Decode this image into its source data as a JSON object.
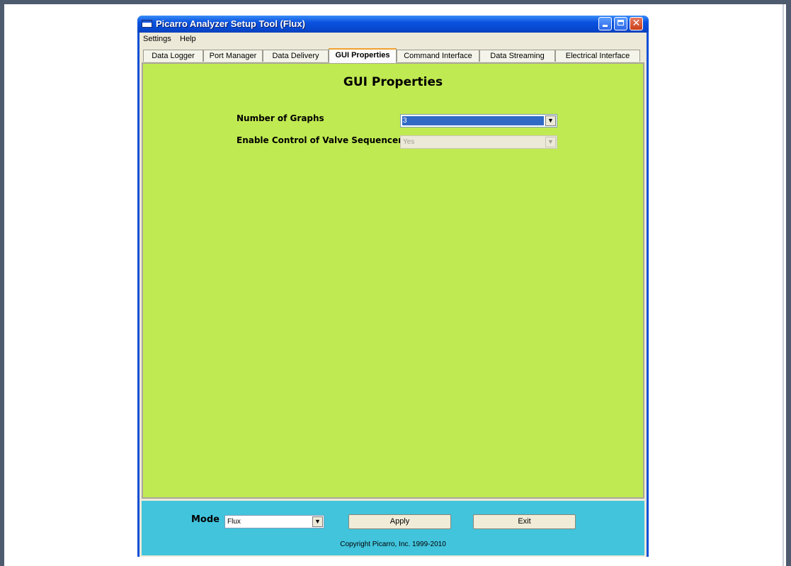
{
  "window": {
    "title": "Picarro Analyzer Setup Tool (Flux)",
    "controls": {
      "minimize": "_",
      "maximize": "□",
      "close": "✕"
    }
  },
  "menubar": {
    "items": [
      "Settings",
      "Help"
    ]
  },
  "tabs": [
    {
      "label": "Data Logger",
      "active": false
    },
    {
      "label": "Port Manager",
      "active": false
    },
    {
      "label": "Data Delivery",
      "active": false
    },
    {
      "label": "GUI Properties",
      "active": true
    },
    {
      "label": "Command Interface",
      "active": false
    },
    {
      "label": "Data Streaming",
      "active": false
    },
    {
      "label": "Electrical Interface",
      "active": false
    }
  ],
  "panel": {
    "title": "GUI Properties",
    "fields": {
      "graphs": {
        "label": "Number of Graphs",
        "value": "3",
        "enabled": true
      },
      "valve": {
        "label": "Enable Control of Valve Sequencer",
        "value": "Yes",
        "enabled": false
      }
    }
  },
  "bottom": {
    "mode_label": "Mode",
    "mode_value": "Flux",
    "apply_label": "Apply",
    "exit_label": "Exit",
    "copyright": "Copyright Picarro, Inc. 1999-2010"
  },
  "colors": {
    "panel_bg": "#c0ea52",
    "bottom_bg": "#42c4dd",
    "titlebar": "#0a52e0",
    "selection": "#316ac5"
  }
}
